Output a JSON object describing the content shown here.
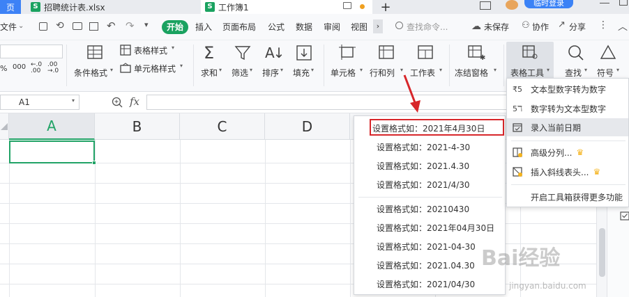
{
  "tabs": {
    "left_partial": "页",
    "file1": "招聘统计表.xlsx",
    "file2": "工作簿1",
    "add": "+",
    "login": "临时登录"
  },
  "menubar": {
    "file": "文件",
    "start": "开始",
    "insert": "插入",
    "layout": "页面布局",
    "formula": "公式",
    "data": "数据",
    "review": "审阅",
    "view": "视图",
    "search_placeholder": "查找命令...",
    "unsaved": "未保存",
    "collab": "协作",
    "share": "分享"
  },
  "ribbon": {
    "cond_format": "条件格式",
    "table_style": "表格样式",
    "cell_style": "单元格样式",
    "sum": "求和",
    "filter": "筛选",
    "sort": "排序",
    "fill": "填充",
    "cell": "单元格",
    "rowcol": "行和列",
    "worksheet": "工作表",
    "freeze": "冻结窗格",
    "table_tools": "表格工具",
    "find": "查找",
    "symbol": "符号",
    "num_fmt": "000",
    "pct": "%"
  },
  "formula_bar": {
    "cell_ref": "A1",
    "fx": "fx",
    "content": ""
  },
  "grid": {
    "columns": [
      "A",
      "B",
      "C",
      "D"
    ]
  },
  "date_menu": {
    "items": [
      "设置格式如：2021年4月30日",
      "设置格式如：2021-4-30",
      "设置格式如：2021.4.30",
      "设置格式如：2021/4/30",
      "设置格式如：20210430",
      "设置格式如：2021年04月30日",
      "设置格式如：2021-04-30",
      "设置格式如：2021.04.30",
      "设置格式如：2021/04/30"
    ]
  },
  "tools_menu": {
    "items": [
      "文本型数字转为数字",
      "数字转为文本型数字",
      "录入当前日期",
      "高级分列...",
      "插入斜线表头..."
    ],
    "footer": "开启工具箱获得更多功能"
  },
  "watermark": {
    "brand": "Bai经验",
    "url": "jingyan.baidu.com"
  },
  "colors": {
    "accent_green": "#1aa260",
    "highlight_red": "#d7262a",
    "selection_green": "#21a366",
    "login_blue": "#3b82f6"
  }
}
